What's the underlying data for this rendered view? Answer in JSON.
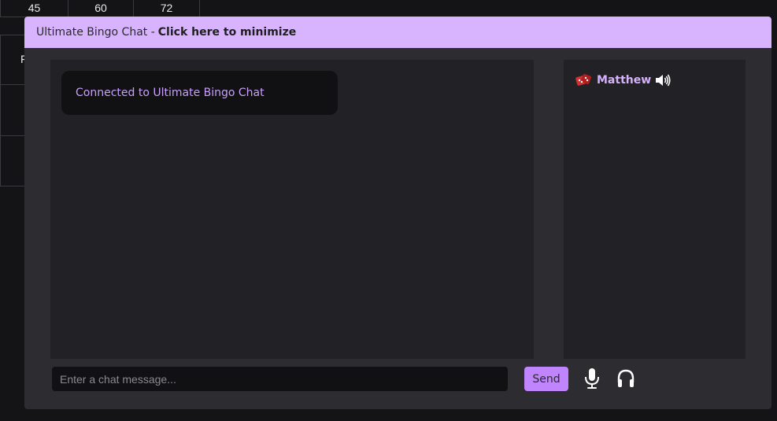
{
  "background_board": {
    "numbers": [
      "45",
      "60",
      "72"
    ],
    "partial_letter": "F"
  },
  "chat": {
    "header": {
      "title": "Ultimate Bingo Chat -",
      "action": "Click here to minimize"
    },
    "messages": [
      {
        "text": "Connected to Ultimate Bingo Chat"
      }
    ],
    "users": [
      {
        "name": "Matthew",
        "avatar": "dice-avatar-icon",
        "status": "speaker-on-icon"
      }
    ],
    "input": {
      "placeholder": "Enter a chat message...",
      "value": ""
    },
    "send_label": "Send",
    "icons": [
      "microphone-icon",
      "headphones-icon"
    ]
  },
  "colors": {
    "header_bg": "#d8b4fe",
    "accent": "#c084fc",
    "panel_bg": "#222226",
    "window_bg": "#2c2c31",
    "page_bg": "#141416"
  }
}
